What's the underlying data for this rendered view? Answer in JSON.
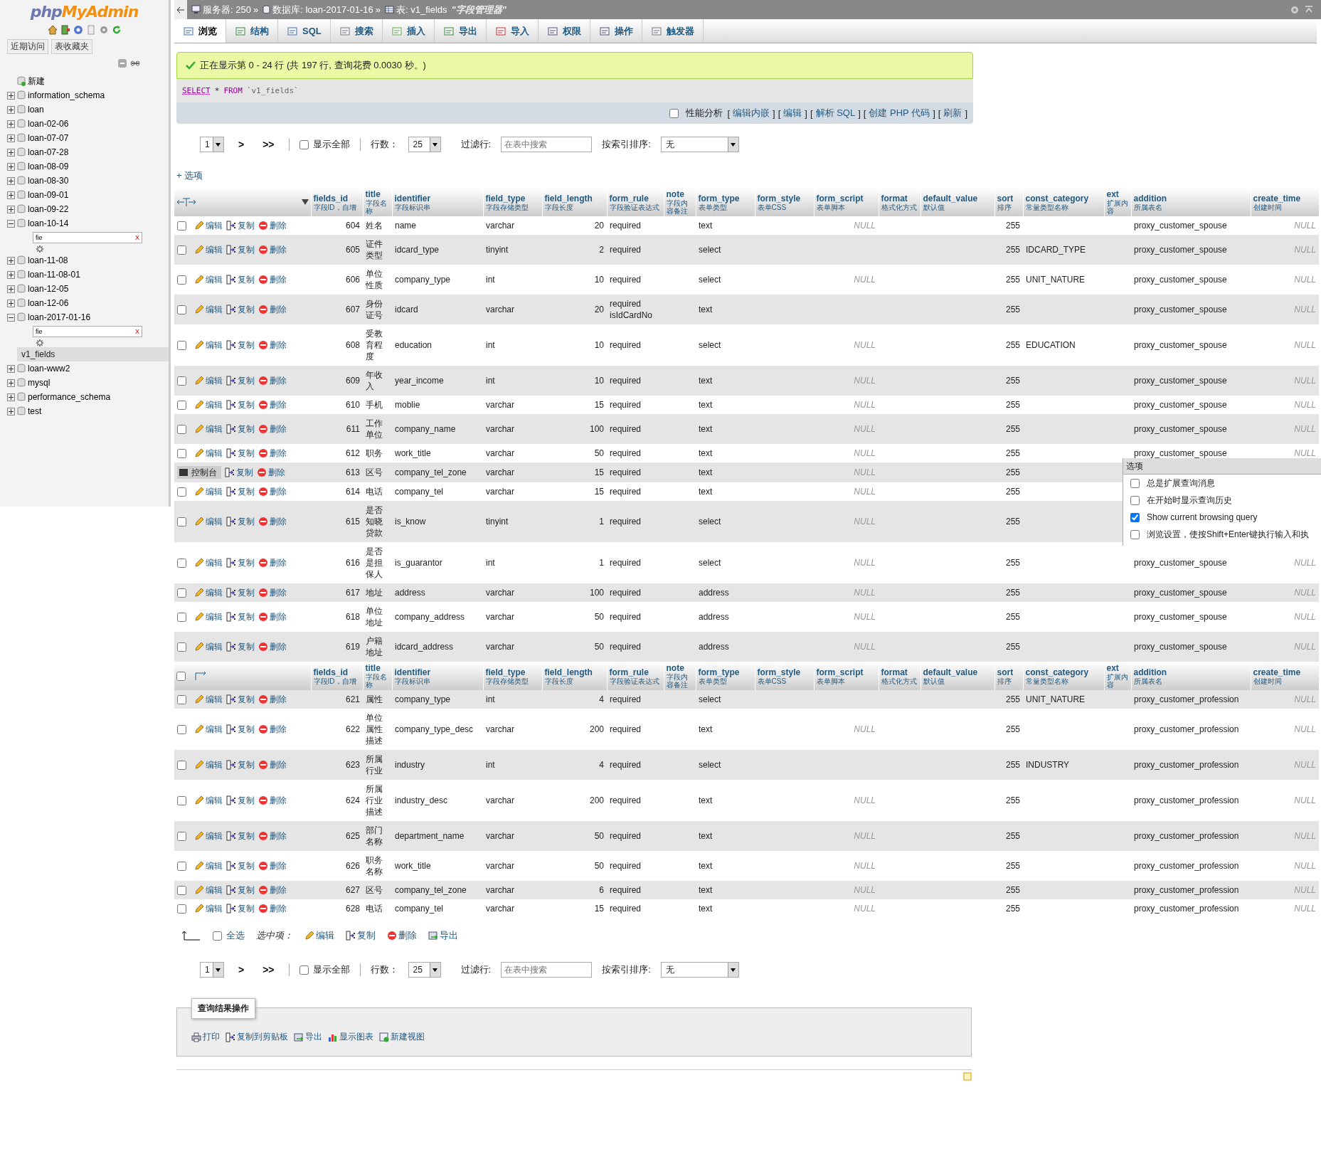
{
  "sidebar": {
    "logo_php": "php",
    "logo_myadmin": "MyAdmin",
    "buttons": [
      "近期访问",
      "表收藏夹"
    ],
    "tree": [
      {
        "label": "新建",
        "kind": "new"
      },
      {
        "label": "information_schema",
        "kind": "db",
        "expanded": false
      },
      {
        "label": "loan",
        "kind": "db",
        "expanded": false
      },
      {
        "label": "loan-02-06",
        "kind": "db",
        "expanded": false
      },
      {
        "label": "loan-07-07",
        "kind": "db",
        "expanded": false
      },
      {
        "label": "loan-07-28",
        "kind": "db",
        "expanded": false
      },
      {
        "label": "loan-08-09",
        "kind": "db",
        "expanded": false
      },
      {
        "label": "loan-08-30",
        "kind": "db",
        "expanded": false
      },
      {
        "label": "loan-09-01",
        "kind": "db",
        "expanded": false
      },
      {
        "label": "loan-09-22",
        "kind": "db",
        "expanded": false
      },
      {
        "label": "loan-10-14",
        "kind": "db",
        "expanded": true,
        "filter": {
          "value": "fie",
          "clear": "X"
        }
      },
      {
        "label": "loan-11-08",
        "kind": "db",
        "expanded": false
      },
      {
        "label": "loan-11-08-01",
        "kind": "db",
        "expanded": false
      },
      {
        "label": "loan-12-05",
        "kind": "db",
        "expanded": false
      },
      {
        "label": "loan-12-06",
        "kind": "db",
        "expanded": false
      },
      {
        "label": "loan-2017-01-16",
        "kind": "db",
        "expanded": true,
        "filter": {
          "value": "fie",
          "clear": "X"
        },
        "children": [
          {
            "label": "v1_fields",
            "selected": true
          }
        ]
      },
      {
        "label": "loan-www2",
        "kind": "db",
        "expanded": false
      },
      {
        "label": "mysql",
        "kind": "db",
        "expanded": false
      },
      {
        "label": "performance_schema",
        "kind": "db",
        "expanded": false
      },
      {
        "label": "test",
        "kind": "db",
        "expanded": false
      }
    ]
  },
  "breadcrumb": {
    "items": [
      {
        "label": "服务器: 250",
        "kind": "server",
        "sep": "»"
      },
      {
        "label": "数据库: loan-2017-01-16",
        "kind": "database",
        "sep": "»"
      },
      {
        "label": "表: v1_fields",
        "kind": "table"
      }
    ],
    "comment": "\"字段管理器\""
  },
  "tabs": [
    {
      "label": "浏览",
      "kind": "browse",
      "selected": true
    },
    {
      "label": "结构",
      "kind": "structure",
      "selected": false
    },
    {
      "label": "SQL",
      "kind": "sql",
      "selected": false
    },
    {
      "label": "搜索",
      "kind": "search",
      "selected": false
    },
    {
      "label": "插入",
      "kind": "insert",
      "selected": false
    },
    {
      "label": "导出",
      "kind": "export",
      "selected": false
    },
    {
      "label": "导入",
      "kind": "import",
      "selected": false
    },
    {
      "label": "权限",
      "kind": "privileges",
      "selected": false
    },
    {
      "label": "操作",
      "kind": "operations",
      "selected": false
    },
    {
      "label": "触发器",
      "kind": "triggers",
      "selected": false
    }
  ],
  "message": "正在显示第 0 - 24 行 (共 197 行, 查询花费 0.0030 秒。)",
  "sql": [
    {
      "text": "SELECT",
      "kind": "keyword"
    },
    {
      "text": "*",
      "kind": "plain"
    },
    {
      "text": "FROM",
      "kind": "keyword"
    },
    {
      "text": "`v1_fields`",
      "kind": "name"
    }
  ],
  "profiling": {
    "label": "性能分析",
    "checked": false,
    "open": "[",
    "close": "]",
    "links": [
      "编辑内嵌",
      "编辑",
      "解析 SQL",
      "创建 PHP 代码",
      "刷新"
    ]
  },
  "navs": [
    {
      "page": "1",
      "next": ">",
      "last": ">>",
      "show_all": {
        "label": "显示全部",
        "checked": false
      },
      "rows_label": "行数：",
      "rows": "25",
      "filter_label": "过滤行:",
      "filter_placeholder": "在表中搜索",
      "sort_label": "按索引排序:",
      "sort": "无"
    },
    {
      "page": "1",
      "next": ">",
      "last": ">>",
      "show_all": {
        "label": "显示全部",
        "checked": false
      },
      "rows_label": "行数：",
      "rows": "25",
      "filter_label": "过滤行:",
      "filter_placeholder": "在表中搜索",
      "sort_label": "按索引排序:",
      "sort": "无"
    }
  ],
  "options_link": "+ 选项",
  "table": {
    "rows": [
      {
        "kind": "header",
        "columns": [
          {
            "name": "fields_id",
            "sub": "字段ID，自增"
          },
          {
            "name": "title",
            "sub": "字段名称"
          },
          {
            "name": "identifier",
            "sub": "字段标识串"
          },
          {
            "name": "field_type",
            "sub": "字段存储类型"
          },
          {
            "name": "field_length",
            "sub": "字段长度"
          },
          {
            "name": "form_rule",
            "sub": "字段验证表达式"
          },
          {
            "name": "note",
            "sub": "字段内容备注"
          },
          {
            "name": "form_type",
            "sub": "表单类型"
          },
          {
            "name": "form_style",
            "sub": "表单CSS"
          },
          {
            "name": "form_script",
            "sub": "表单脚本"
          },
          {
            "name": "format",
            "sub": "格式化方式"
          },
          {
            "name": "default_value",
            "sub": "默认值"
          },
          {
            "name": "sort",
            "sub": "排序"
          },
          {
            "name": "const_category",
            "sub": "常量类型名称"
          },
          {
            "name": "ext",
            "sub": "扩展内容"
          },
          {
            "name": "addition",
            "sub": "所属表名"
          },
          {
            "name": "create_time",
            "sub": "创建时间"
          }
        ]
      },
      {
        "kind": "row",
        "checked": false,
        "edit": "编辑",
        "copy": "复制",
        "delete": "删除",
        "id": "604",
        "title": "姓名",
        "identifier": "name",
        "field_type": "varchar",
        "field_length": "20",
        "form_rule": "required",
        "form_type": "text",
        "form_script": "NULL",
        "sort": "255",
        "addition": "proxy_customer_spouse",
        "create_time": "NULL"
      },
      {
        "kind": "row",
        "checked": false,
        "edit": "编辑",
        "copy": "复制",
        "delete": "删除",
        "id": "605",
        "title": "证件类型",
        "identifier": "idcard_type",
        "field_type": "tinyint",
        "field_length": "2",
        "form_rule": "required",
        "form_type": "select",
        "sort": "255",
        "const_category": "IDCARD_TYPE",
        "addition": "proxy_customer_spouse",
        "create_time": "NULL"
      },
      {
        "kind": "row",
        "checked": false,
        "edit": "编辑",
        "copy": "复制",
        "delete": "删除",
        "id": "606",
        "title": "单位性质",
        "identifier": "company_type",
        "field_type": "int",
        "field_length": "10",
        "form_rule": "required",
        "form_type": "select",
        "form_script": "NULL",
        "sort": "255",
        "const_category": "UNIT_NATURE",
        "addition": "proxy_customer_spouse",
        "create_time": "NULL"
      },
      {
        "kind": "row",
        "checked": false,
        "edit": "编辑",
        "copy": "复制",
        "delete": "删除",
        "id": "607",
        "title": "身份证号",
        "identifier": "idcard",
        "field_type": "varchar",
        "field_length": "20",
        "form_rule": "required\nisIdCardNo",
        "form_type": "text",
        "sort": "255",
        "addition": "proxy_customer_spouse",
        "create_time": "NULL"
      },
      {
        "kind": "row",
        "checked": false,
        "edit": "编辑",
        "copy": "复制",
        "delete": "删除",
        "id": "608",
        "title": "受教育程度",
        "identifier": "education",
        "field_type": "int",
        "field_length": "10",
        "form_rule": "required",
        "form_type": "select",
        "form_script": "NULL",
        "sort": "255",
        "const_category": "EDUCATION",
        "addition": "proxy_customer_spouse",
        "create_time": "NULL"
      },
      {
        "kind": "row",
        "checked": false,
        "edit": "编辑",
        "copy": "复制",
        "delete": "删除",
        "id": "609",
        "title": "年收入",
        "identifier": "year_income",
        "field_type": "int",
        "field_length": "10",
        "form_rule": "required",
        "form_type": "text",
        "form_script": "NULL",
        "sort": "255",
        "addition": "proxy_customer_spouse",
        "create_time": "NULL"
      },
      {
        "kind": "row",
        "checked": false,
        "edit": "编辑",
        "copy": "复制",
        "delete": "删除",
        "id": "610",
        "title": "手机",
        "identifier": "moblie",
        "field_type": "varchar",
        "field_length": "15",
        "form_rule": "required",
        "form_type": "text",
        "form_script": "NULL",
        "sort": "255",
        "addition": "proxy_customer_spouse",
        "create_time": "NULL"
      },
      {
        "kind": "row",
        "checked": false,
        "edit": "编辑",
        "copy": "复制",
        "delete": "删除",
        "id": "611",
        "title": "工作单位",
        "identifier": "company_name",
        "field_type": "varchar",
        "field_length": "100",
        "form_rule": "required",
        "form_type": "text",
        "form_script": "NULL",
        "sort": "255",
        "addition": "proxy_customer_spouse",
        "create_time": "NULL"
      },
      {
        "kind": "row",
        "checked": false,
        "edit": "编辑",
        "copy": "复制",
        "delete": "删除",
        "id": "612",
        "title": "职务",
        "identifier": "work_title",
        "field_type": "varchar",
        "field_length": "50",
        "form_rule": "required",
        "form_type": "text",
        "form_script": "NULL",
        "sort": "255",
        "addition": "proxy_customer_spouse",
        "create_time": "NULL"
      },
      {
        "kind": "row",
        "console": {
          "label": "控制台",
          "panel": {
            "title": "选项",
            "options": [
              {
                "label": "总是扩展查询消息",
                "checked": false
              },
              {
                "label": "在开始时显示查询历史",
                "checked": false
              },
              {
                "label": "Show current browsing query",
                "checked": true
              },
              {
                "label": "浏览设置，使按Shift+Enter键执行输入和执",
                "checked": false
              }
            ]
          }
        },
        "copy": "复制",
        "delete": "删除",
        "id": "613",
        "title": "区号",
        "identifier": "company_tel_zone",
        "field_type": "varchar",
        "field_length": "15",
        "form_rule": "required",
        "form_type": "text",
        "form_script": "NULL",
        "sort": "255"
      },
      {
        "kind": "row",
        "checked": false,
        "edit": "编辑",
        "copy": "复制",
        "delete": "删除",
        "id": "614",
        "title": "电话",
        "identifier": "company_tel",
        "field_type": "varchar",
        "field_length": "15",
        "form_rule": "required",
        "form_type": "text",
        "form_script": "NULL",
        "sort": "255"
      },
      {
        "kind": "row",
        "checked": false,
        "edit": "编辑",
        "copy": "复制",
        "delete": "删除",
        "id": "615",
        "title": "是否知晓贷款",
        "identifier": "is_know",
        "field_type": "tinyint",
        "field_length": "1",
        "form_rule": "required",
        "form_type": "select",
        "form_script": "NULL",
        "sort": "255"
      },
      {
        "kind": "row",
        "checked": false,
        "edit": "编辑",
        "copy": "复制",
        "delete": "删除",
        "id": "616",
        "title": "是否是担保人",
        "identifier": "is_guarantor",
        "field_type": "int",
        "field_length": "1",
        "form_rule": "required",
        "form_type": "select",
        "form_script": "NULL",
        "sort": "255",
        "addition": "proxy_customer_spouse",
        "create_time": "NULL"
      },
      {
        "kind": "row",
        "checked": false,
        "edit": "编辑",
        "copy": "复制",
        "delete": "删除",
        "id": "617",
        "title": "地址",
        "identifier": "address",
        "field_type": "varchar",
        "field_length": "100",
        "form_rule": "required",
        "form_type": "address",
        "form_script": "NULL",
        "sort": "255",
        "addition": "proxy_customer_spouse",
        "create_time": "NULL"
      },
      {
        "kind": "row",
        "checked": false,
        "edit": "编辑",
        "copy": "复制",
        "delete": "删除",
        "id": "618",
        "title": "单位地址",
        "identifier": "company_address",
        "field_type": "varchar",
        "field_length": "50",
        "form_rule": "required",
        "form_type": "address",
        "form_script": "NULL",
        "sort": "255",
        "addition": "proxy_customer_spouse",
        "create_time": "NULL"
      },
      {
        "kind": "row",
        "checked": false,
        "edit": "编辑",
        "copy": "复制",
        "delete": "删除",
        "id": "619",
        "title": "户籍地址",
        "identifier": "idcard_address",
        "field_type": "varchar",
        "field_length": "50",
        "form_rule": "required",
        "form_type": "address",
        "form_script": "NULL",
        "sort": "255",
        "addition": "proxy_customer_spouse",
        "create_time": "NULL"
      },
      {
        "kind": "repeated_header",
        "checked": false,
        "columns": [
          {
            "name": "fields_id",
            "sub": "字段ID，自增"
          },
          {
            "name": "title",
            "sub": "字段名称"
          },
          {
            "name": "identifier",
            "sub": "字段标识串"
          },
          {
            "name": "field_type",
            "sub": "字段存储类型"
          },
          {
            "name": "field_length",
            "sub": "字段长度"
          },
          {
            "name": "form_rule",
            "sub": "字段验证表达式"
          },
          {
            "name": "note",
            "sub": "字段内容备注"
          },
          {
            "name": "form_type",
            "sub": "表单类型"
          },
          {
            "name": "form_style",
            "sub": "表单CSS"
          },
          {
            "name": "form_script",
            "sub": "表单脚本"
          },
          {
            "name": "format",
            "sub": "格式化方式"
          },
          {
            "name": "default_value",
            "sub": "默认值"
          },
          {
            "name": "sort",
            "sub": "排序"
          },
          {
            "name": "const_category",
            "sub": "常量类型名称"
          },
          {
            "name": "ext",
            "sub": "扩展内容"
          },
          {
            "name": "addition",
            "sub": "所属表名"
          },
          {
            "name": "create_time",
            "sub": "创建时间"
          }
        ]
      },
      {
        "kind": "row",
        "checked": false,
        "edit": "编辑",
        "copy": "复制",
        "delete": "删除",
        "id": "621",
        "title": "属性",
        "identifier": "company_type",
        "field_type": "int",
        "field_length": "4",
        "form_rule": "required",
        "form_type": "select",
        "sort": "255",
        "const_category": "UNIT_NATURE",
        "addition": "proxy_customer_profession",
        "create_time": "NULL"
      },
      {
        "kind": "row",
        "checked": false,
        "edit": "编辑",
        "copy": "复制",
        "delete": "删除",
        "id": "622",
        "title": "单位属性描述",
        "identifier": "company_type_desc",
        "field_type": "varchar",
        "field_length": "200",
        "form_rule": "required",
        "form_type": "text",
        "form_script": "NULL",
        "sort": "255",
        "addition": "proxy_customer_profession",
        "create_time": "NULL"
      },
      {
        "kind": "row",
        "checked": false,
        "edit": "编辑",
        "copy": "复制",
        "delete": "删除",
        "id": "623",
        "title": "所属行业",
        "identifier": "industry",
        "field_type": "int",
        "field_length": "4",
        "form_rule": "required",
        "form_type": "select",
        "sort": "255",
        "const_category": "INDUSTRY",
        "addition": "proxy_customer_profession",
        "create_time": "NULL"
      },
      {
        "kind": "row",
        "checked": false,
        "edit": "编辑",
        "copy": "复制",
        "delete": "删除",
        "id": "624",
        "title": "所属行业描述",
        "identifier": "industry_desc",
        "field_type": "varchar",
        "field_length": "200",
        "form_rule": "required",
        "form_type": "text",
        "form_script": "NULL",
        "sort": "255",
        "addition": "proxy_customer_profession",
        "create_time": "NULL"
      },
      {
        "kind": "row",
        "checked": false,
        "edit": "编辑",
        "copy": "复制",
        "delete": "删除",
        "id": "625",
        "title": "部门名称",
        "identifier": "department_name",
        "field_type": "varchar",
        "field_length": "50",
        "form_rule": "required",
        "form_type": "text",
        "form_script": "NULL",
        "sort": "255",
        "addition": "proxy_customer_profession",
        "create_time": "NULL"
      },
      {
        "kind": "row",
        "checked": false,
        "edit": "编辑",
        "copy": "复制",
        "delete": "删除",
        "id": "626",
        "title": "职务名称",
        "identifier": "work_title",
        "field_type": "varchar",
        "field_length": "50",
        "form_rule": "required",
        "form_type": "text",
        "form_script": "NULL",
        "sort": "255",
        "addition": "proxy_customer_profession",
        "create_time": "NULL"
      },
      {
        "kind": "row",
        "checked": false,
        "edit": "编辑",
        "copy": "复制",
        "delete": "删除",
        "id": "627",
        "title": "区号",
        "identifier": "company_tel_zone",
        "field_type": "varchar",
        "field_length": "6",
        "form_rule": "required",
        "form_type": "text",
        "form_script": "NULL",
        "sort": "255",
        "addition": "proxy_customer_profession",
        "create_time": "NULL"
      },
      {
        "kind": "row",
        "checked": false,
        "edit": "编辑",
        "copy": "复制",
        "delete": "删除",
        "id": "628",
        "title": "电话",
        "identifier": "company_tel",
        "field_type": "varchar",
        "field_length": "15",
        "form_rule": "required",
        "form_type": "text",
        "form_script": "NULL",
        "sort": "255",
        "addition": "proxy_customer_profession",
        "create_time": "NULL"
      }
    ]
  },
  "bulk": {
    "select_all": {
      "label": "全选",
      "checked": false
    },
    "with_selected": "选中项：",
    "actions": [
      {
        "kind": "edit",
        "label": "编辑"
      },
      {
        "kind": "copy",
        "label": "复制"
      },
      {
        "kind": "delete",
        "label": "删除"
      },
      {
        "kind": "export",
        "label": "导出"
      }
    ]
  },
  "result_ops": {
    "legend": "查询结果操作",
    "actions": [
      {
        "kind": "print",
        "label": "打印"
      },
      {
        "kind": "copy",
        "label": "复制到剪贴板"
      },
      {
        "kind": "export",
        "label": "导出"
      },
      {
        "kind": "chart",
        "label": "显示图表"
      },
      {
        "kind": "view",
        "label": "新建视图"
      }
    ]
  }
}
